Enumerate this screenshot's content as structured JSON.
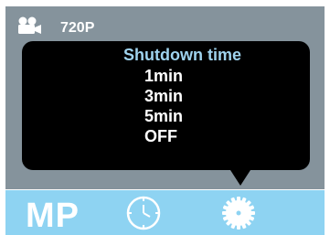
{
  "status": {
    "resolution": "720P",
    "mode_icon": "video-camera-icon"
  },
  "popup": {
    "title": "Shutdown time",
    "options": [
      "1min",
      "3min",
      "5min",
      "OFF"
    ]
  },
  "bottom_bar": {
    "mode_label": "MP",
    "icons": [
      "timer-icon",
      "gear-icon"
    ]
  },
  "colors": {
    "top_background": "#85939c",
    "bottom_background": "#8ed3f2",
    "popup_background": "#000000",
    "title_color": "#9fd3ee",
    "text": "#ffffff"
  }
}
